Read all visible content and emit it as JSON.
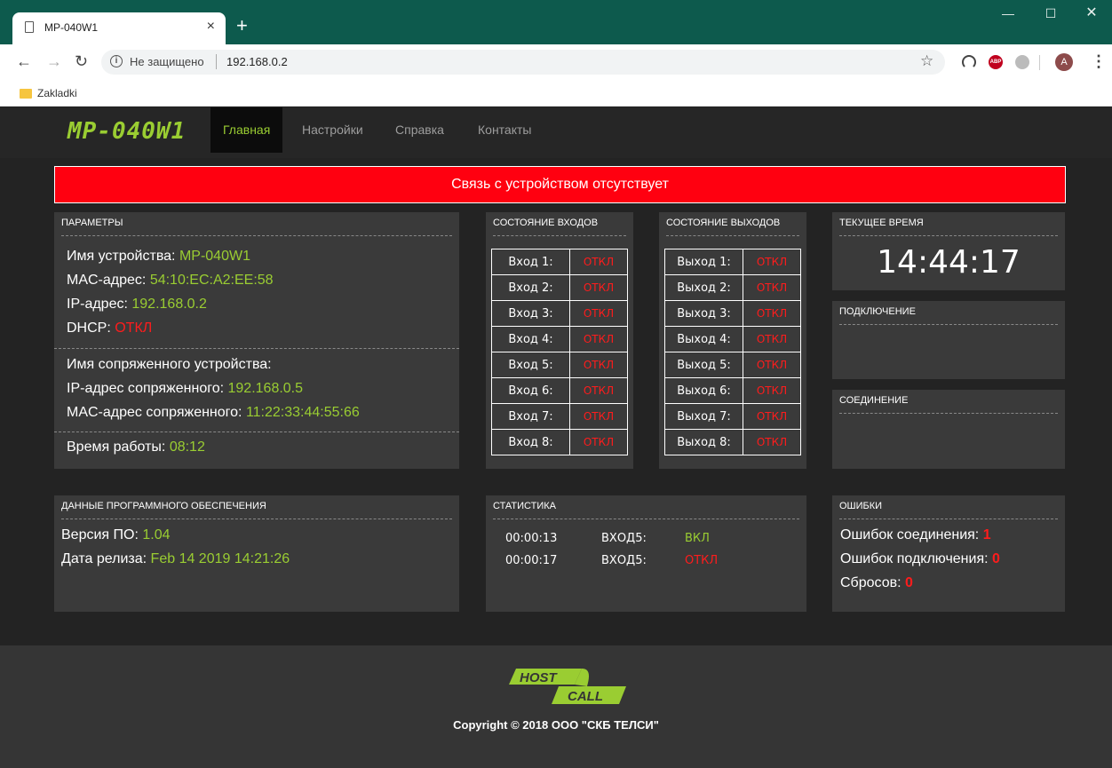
{
  "browser": {
    "tab_title": "MP-040W1",
    "security_text": "Не защищено",
    "url": "192.168.0.2",
    "avatar_letter": "A",
    "bookmark_folder": "Zakladki",
    "abp_label": "ABP"
  },
  "header": {
    "brand": "MP-040W1",
    "nav": [
      {
        "label": "Главная",
        "active": true
      },
      {
        "label": "Настройки",
        "active": false
      },
      {
        "label": "Справка",
        "active": false
      },
      {
        "label": "Контакты",
        "active": false
      }
    ]
  },
  "alert": "Связь с устройством отсутствует",
  "params": {
    "title": "ПАРАМЕТРЫ",
    "device_name_label": "Имя устройства:",
    "device_name": "MP-040W1",
    "mac_label": "MAC-адрес:",
    "mac": "54:10:EC:A2:EE:58",
    "ip_label": "IP-адрес:",
    "ip": "192.168.0.2",
    "dhcp_label": "DHCP:",
    "dhcp": "ОТКЛ",
    "paired_name_label": "Имя сопряженного устройства:",
    "paired_ip_label": "IP-адрес сопряженного:",
    "paired_ip": "192.168.0.5",
    "paired_mac_label": "MAC-адрес сопряженного:",
    "paired_mac": "11:22:33:44:55:66",
    "uptime_label": "Время работы:",
    "uptime": "08:12"
  },
  "inputs": {
    "title": "СОСТОЯНИЕ ВХОДОВ",
    "rows": [
      {
        "label": "Вход 1:",
        "state": "ОТКЛ"
      },
      {
        "label": "Вход 2:",
        "state": "ОТКЛ"
      },
      {
        "label": "Вход 3:",
        "state": "ОТКЛ"
      },
      {
        "label": "Вход 4:",
        "state": "ОТКЛ"
      },
      {
        "label": "Вход 5:",
        "state": "ОТКЛ"
      },
      {
        "label": "Вход 6:",
        "state": "ОТКЛ"
      },
      {
        "label": "Вход 7:",
        "state": "ОТКЛ"
      },
      {
        "label": "Вход 8:",
        "state": "ОТКЛ"
      }
    ]
  },
  "outputs": {
    "title": "СОСТОЯНИЕ ВЫХОДОВ",
    "rows": [
      {
        "label": "Выход 1:",
        "state": "ОТКЛ"
      },
      {
        "label": "Выход 2:",
        "state": "ОТКЛ"
      },
      {
        "label": "Выход 3:",
        "state": "ОТКЛ"
      },
      {
        "label": "Выход 4:",
        "state": "ОТКЛ"
      },
      {
        "label": "Выход 5:",
        "state": "ОТКЛ"
      },
      {
        "label": "Выход 6:",
        "state": "ОТКЛ"
      },
      {
        "label": "Выход 7:",
        "state": "ОТКЛ"
      },
      {
        "label": "Выход 8:",
        "state": "ОТКЛ"
      }
    ]
  },
  "time": {
    "title": "ТЕКУЩЕЕ ВРЕМЯ",
    "value": "14:44:17"
  },
  "connection": {
    "title": "ПОДКЛЮЧЕНИЕ"
  },
  "link": {
    "title": "СОЕДИНЕНИЕ"
  },
  "software": {
    "title": "ДАННЫЕ ПРОГРАММНОГО ОБЕСПЕЧЕНИЯ",
    "version_label": "Версия ПО:",
    "version": "1.04",
    "release_label": "Дата релиза:",
    "release": "Feb 14 2019 14:21:26"
  },
  "stats": {
    "title": "СТАТИСТИКА",
    "rows": [
      {
        "time": "00:00:13",
        "event": "ВХОД5:",
        "state": "ВКЛ",
        "on": true
      },
      {
        "time": "00:00:17",
        "event": "ВХОД5:",
        "state": "ОТКЛ",
        "on": false
      }
    ]
  },
  "errors": {
    "title": "ОШИБКИ",
    "link_label": "Ошибок соединения:",
    "link_count": "1",
    "conn_label": "Ошибок подключения:",
    "conn_count": "0",
    "resets_label": "Сбросов:",
    "resets_count": "0"
  },
  "footer": {
    "logo_top": "HOST",
    "logo_bottom": "CALL",
    "copyright": "Copyright © 2018 ООО \"СКБ ТЕЛСИ\""
  },
  "colors": {
    "accent": "#9acd32",
    "off": "#ff1c1c",
    "alert_bg": "#ff0010"
  }
}
